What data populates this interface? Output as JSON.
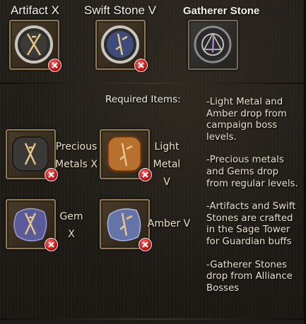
{
  "top_items": [
    {
      "title": "Artifact X",
      "icon": "artifact-rune-icon",
      "missing": true
    },
    {
      "title": "Swift Stone V",
      "icon": "swift-stone-rune-icon",
      "missing": true
    },
    {
      "title": "Gatherer Stone",
      "icon": "gatherer-stone-icon",
      "missing": false
    }
  ],
  "required_title": "Required Items:",
  "required_items": [
    {
      "label_line1": "Precious",
      "label_line2": "Metals X",
      "icon": "precious-metal-rune-icon",
      "missing": true
    },
    {
      "label_line1": "Light",
      "label_line2": "Metal V",
      "icon": "light-metal-rune-icon",
      "missing": true
    },
    {
      "label_line1": "Gem X",
      "label_line2": "",
      "icon": "gem-rune-icon",
      "missing": true
    },
    {
      "label_line1": "Amber V",
      "label_line2": "",
      "icon": "amber-rune-icon",
      "missing": true
    }
  ],
  "info": [
    "-Light Metal and Amber drop from campaign boss levels.",
    "-Precious metals and Gems drop from regular levels.",
    "-Artifacts and Swift Stones are crafted in the Sage Tower for Guardian buffs",
    "-Gatherer Stones drop from Alliance Bosses"
  ],
  "colors": {
    "missing_badge": "#c01414",
    "frame_gold": "#8e7a52",
    "rune_glyph": "#e7c68a"
  }
}
